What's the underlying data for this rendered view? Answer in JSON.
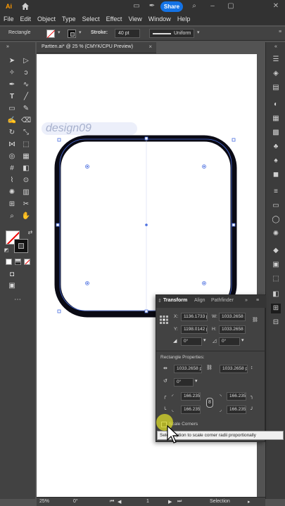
{
  "app": {
    "logo": "Ai",
    "share_label": "Share"
  },
  "menu": [
    "File",
    "Edit",
    "Object",
    "Type",
    "Select",
    "Effect",
    "View",
    "Window",
    "Help"
  ],
  "controlbar": {
    "object_type": "Rectangle",
    "stroke_label": "Stroke:",
    "stroke_value": "40 pt",
    "profile_label": "Uniform"
  },
  "document": {
    "tab_title": "Partten.ai* @ 25 % (CMYK/CPU Preview)",
    "close": "×"
  },
  "watermark": "design09",
  "transform_panel": {
    "tabs": [
      "Transform",
      "Align",
      "Pathfinder"
    ],
    "x_label": "X:",
    "x_value": "1136.1733 p",
    "y_label": "Y:",
    "y_value": "1198.0142 p",
    "w_label": "W:",
    "w_value": "1033.2658 p",
    "h_label": "H:",
    "h_value": "1033.2658 p",
    "rotate_value": "0°",
    "shear_value": "0°",
    "rect_props_label": "Rectangle Properties:",
    "rect_w_value": "1033.2658 p",
    "rect_h_value": "1033.2658 p",
    "rect_rotate_value": "0°",
    "corner_tl": "166.235",
    "corner_tr": "166.235",
    "corner_bl": "166.235",
    "corner_br": "166.235",
    "scale_corners_label": "Scale Corners",
    "tooltip": "Select option to scale corner radii proportionally"
  },
  "status": {
    "zoom": "25%",
    "rotation": "0°",
    "page": "1",
    "tool": "Selection"
  },
  "colors": {
    "accent": "#1473e6",
    "selection": "#4a6ee0",
    "stroke": "#0a0a14"
  }
}
